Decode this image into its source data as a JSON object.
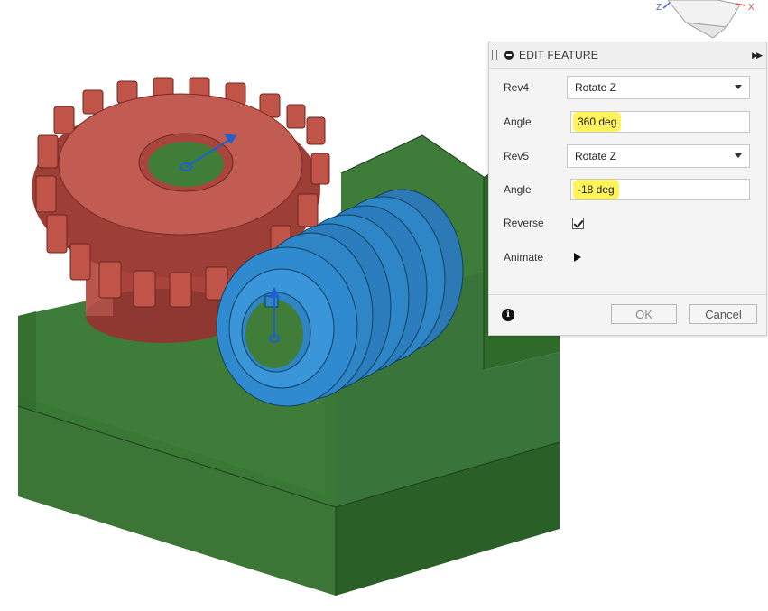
{
  "panel": {
    "title": "EDIT FEATURE",
    "expand_icon": "double-chevron-right-icon",
    "rows": {
      "rev4_label": "Rev4",
      "rev4_value": "Rotate Z",
      "angle1_label": "Angle",
      "angle1_value": "360 deg",
      "rev5_label": "Rev5",
      "rev5_value": "Rotate Z",
      "angle2_label": "Angle",
      "angle2_value": "-18 deg",
      "reverse_label": "Reverse",
      "reverse_checked": true,
      "animate_label": "Animate"
    },
    "ok_label": "OK",
    "cancel_label": "Cancel"
  },
  "viewcube": {
    "axis_z": "Z",
    "axis_x": "X"
  },
  "colors": {
    "base_green": "#3f7a3a",
    "gear_red": "#b54a40",
    "worm_blue": "#2f86c6",
    "highlight": "#fff35a"
  }
}
